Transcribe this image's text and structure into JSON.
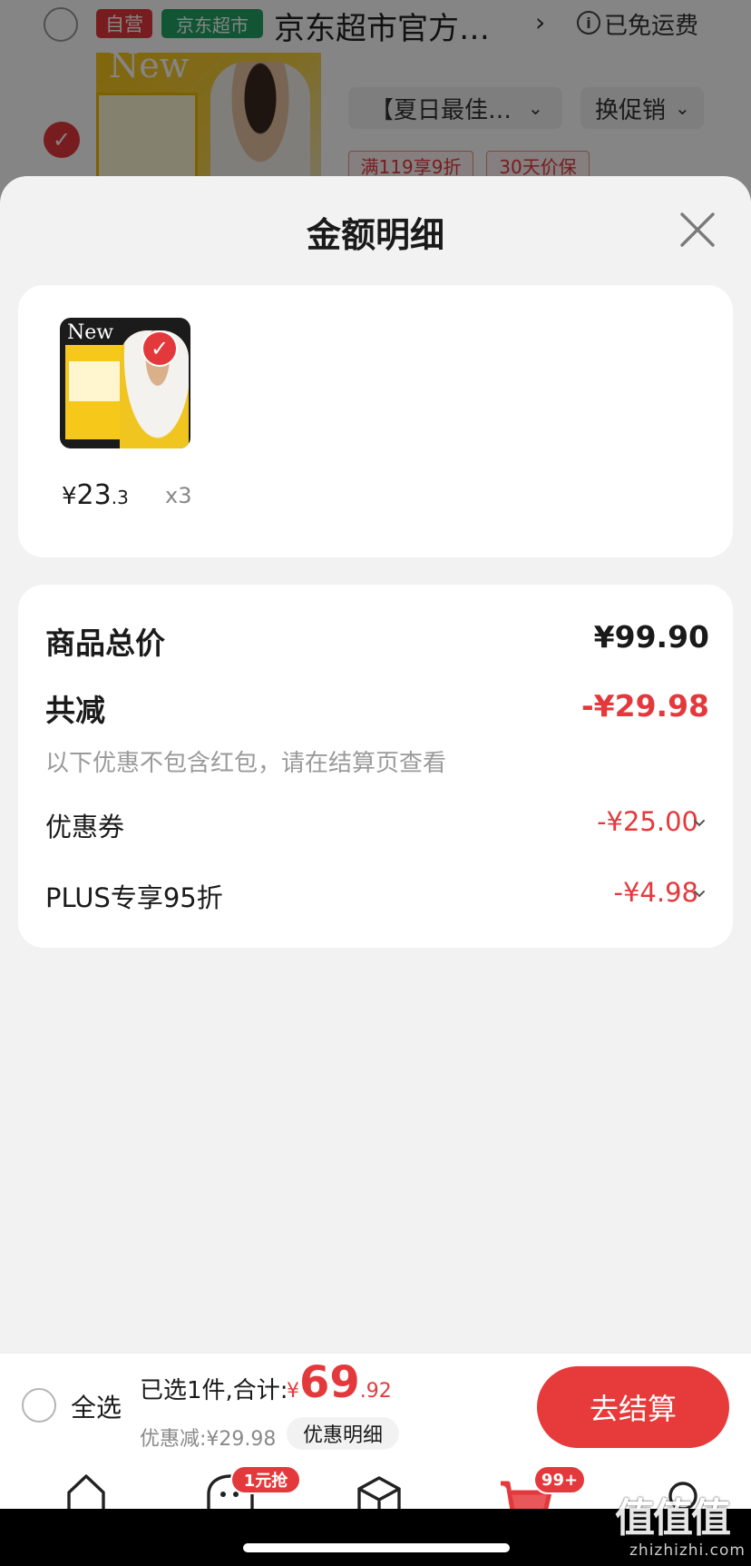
{
  "background": {
    "store_tag_self": "自营",
    "store_tag_jd": "京东超市",
    "store_name": "京东超市官方…",
    "store_arrow": "›",
    "free_shipping": "已免运费",
    "product_image_text": "New",
    "spec_select": "【夏日最佳…",
    "promo_select": "换促销",
    "promo_tags": [
      "满119享9折",
      "30天价保"
    ]
  },
  "sheet": {
    "title": "金额明细",
    "item": {
      "image_text": "New",
      "price_currency": "¥",
      "price_int": "23",
      "price_dec": ".3",
      "quantity": "x3"
    },
    "summary": {
      "total_label": "商品总价",
      "total_amount": "¥99.90",
      "reduce_label": "共减",
      "reduce_amount": "-¥29.98",
      "note": "以下优惠不包含红包，请在结算页查看",
      "discounts": [
        {
          "label": "优惠券",
          "amount": "-¥25.00"
        },
        {
          "label": "PLUS专享95折",
          "amount": "-¥4.98"
        }
      ]
    }
  },
  "bottom_bar": {
    "select_all": "全选",
    "selected_summary": "已选1件,合计:",
    "total_currency": "¥",
    "total_int": "69",
    "total_dec": ".92",
    "discount_summary": "优惠减:¥29.98",
    "detail_button": "优惠明细",
    "checkout_button": "去结算"
  },
  "tab_bar": {
    "badge_1": "1元抢",
    "badge_cart": "99+"
  },
  "watermark": {
    "logo": "值值值",
    "url": "zhizhizhi.com"
  },
  "colors": {
    "accent_red": "#e4393c",
    "jd_green": "#21a366",
    "sheet_bg": "#f2f2f2"
  }
}
